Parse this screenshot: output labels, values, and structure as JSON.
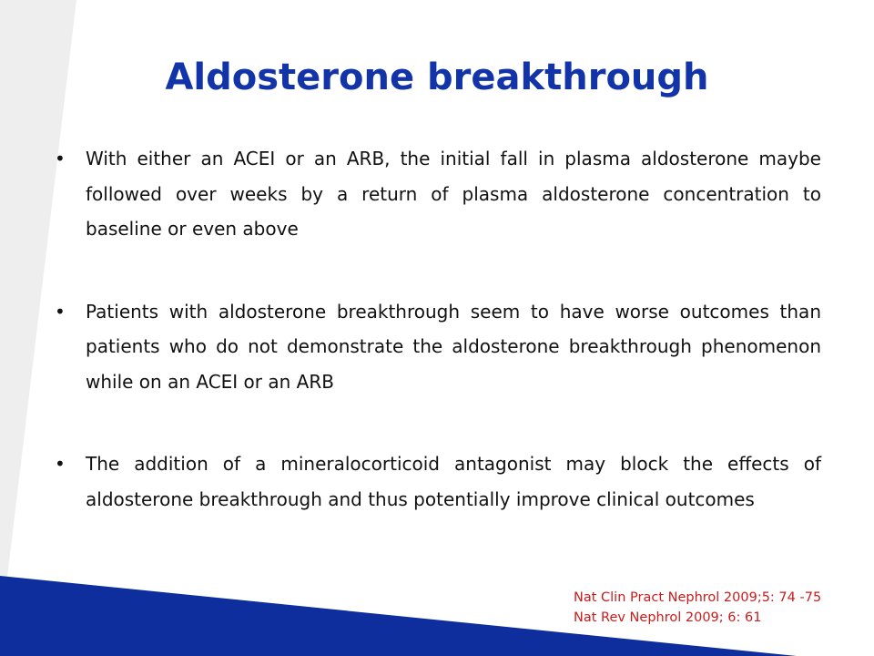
{
  "slide": {
    "title": "Aldosterone breakthrough",
    "bullets": [
      {
        "marker": "•",
        "text": "With either an ACEI or an ARB, the initial fall in plasma aldosterone maybe followed over weeks by a return of plasma aldosterone concentration to baseline or even above"
      },
      {
        "marker": "•",
        "text": "Patients with aldosterone breakthrough seem to have worse outcomes than patients who do not demonstrate the aldosterone breakthrough phenomenon while on an ACEI or an ARB"
      },
      {
        "marker": "•",
        "text": "The addition of a mineralocorticoid antagonist may block the effects of aldosterone breakthrough and thus potentially improve clinical outcomes"
      }
    ],
    "references": [
      "Nat Clin Pract Nephrol 2009;5: 74 -75",
      "Nat Rev Nephrol 2009; 6: 61"
    ]
  },
  "colors": {
    "title": "#1234a8",
    "body_text": "#111111",
    "reference_text": "#cc1b1b",
    "band_blue": "#0f2e9e",
    "side_panel_gray": "#eeeeee"
  }
}
